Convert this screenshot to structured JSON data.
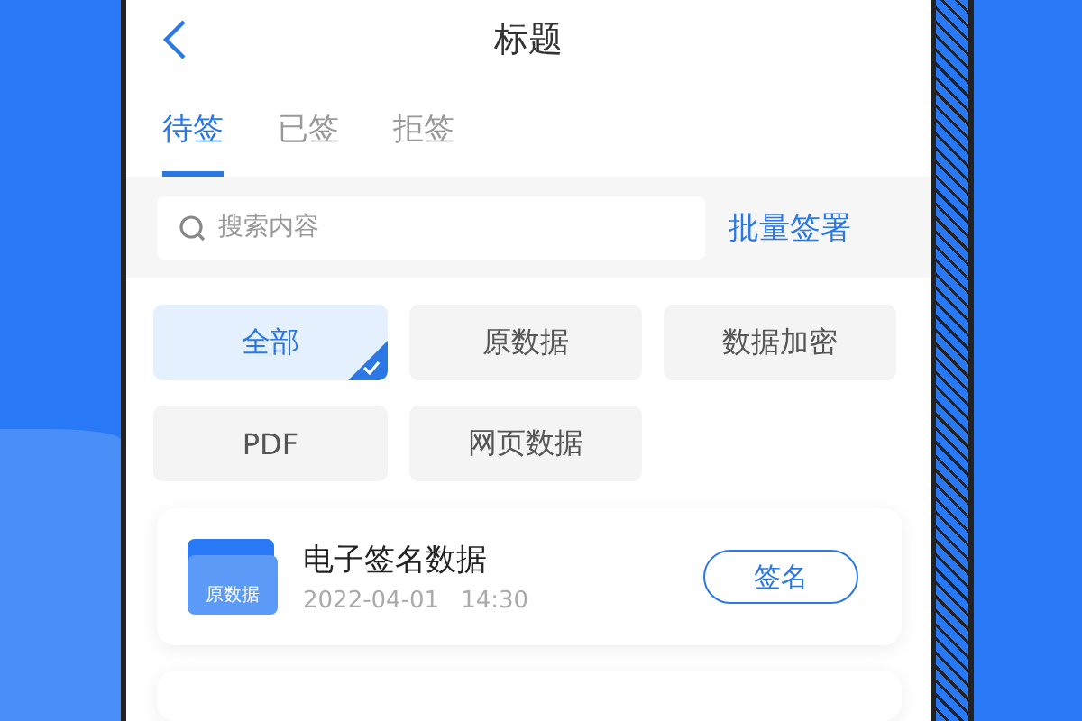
{
  "header": {
    "title": "标题"
  },
  "tabs": [
    {
      "label": "待签",
      "selected": true
    },
    {
      "label": "已签",
      "selected": false
    },
    {
      "label": "拒签",
      "selected": false
    }
  ],
  "search": {
    "placeholder": "搜索内容"
  },
  "batch_action": "批量签署",
  "filters": [
    {
      "label": "全部",
      "selected": true
    },
    {
      "label": "原数据",
      "selected": false
    },
    {
      "label": "数据加密",
      "selected": false
    },
    {
      "label": "PDF",
      "selected": false
    },
    {
      "label": "网页数据",
      "selected": false
    }
  ],
  "documents": [
    {
      "badge": "原数据",
      "title": "电子签名数据",
      "date": "2022-04-01",
      "time": "14:30",
      "action": "签名"
    }
  ]
}
